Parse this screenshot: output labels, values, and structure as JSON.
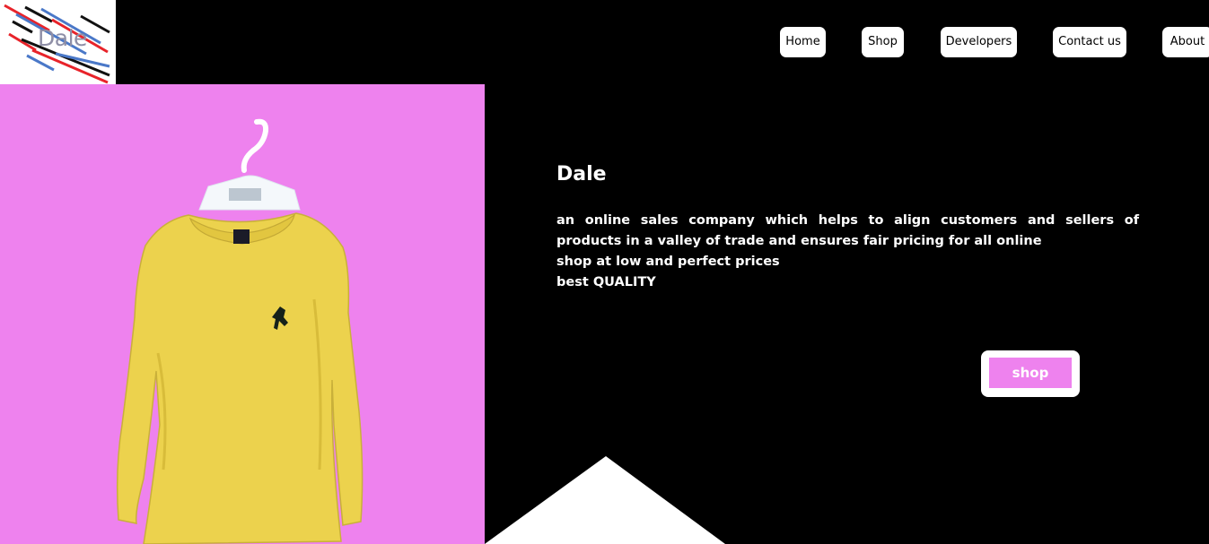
{
  "brand": {
    "logo_text": "Dale",
    "colors": {
      "accent": "#ee82ee",
      "stripe_red": "#e8232a",
      "stripe_blue": "#4a78c8",
      "stripe_black": "#111111"
    }
  },
  "nav": {
    "items": [
      {
        "label": "Home"
      },
      {
        "label": "Shop"
      },
      {
        "label": "Developers"
      },
      {
        "label": "Contact us"
      },
      {
        "label": "About"
      }
    ]
  },
  "hero": {
    "title": "Dale",
    "description": "an online sales company which helps to align customers and sellers of products in a valley of trade and ensures fair pricing for all online",
    "line2": "shop at low and perfect prices",
    "line3": "best QUALITY",
    "cta_label": "shop",
    "image": {
      "subject": "yellow long-sleeve shirt on white hanger",
      "background": "#ee82ee"
    }
  }
}
